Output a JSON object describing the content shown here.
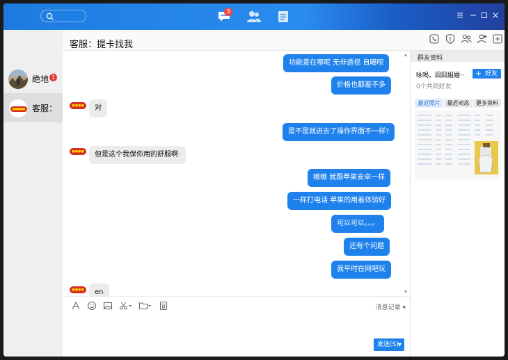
{
  "header": {
    "nav_badge": "3",
    "chat_title": "客服：提卡找我"
  },
  "sidebar": {
    "items": [
      {
        "name": "绝地",
        "unread": "1",
        "active": false
      },
      {
        "name": "客服：",
        "unread": "",
        "active": true
      }
    ]
  },
  "messages": [
    {
      "from": "me",
      "text": "功能差在哪呢    无非透视  自瞄呗"
    },
    {
      "from": "me",
      "text": "价格也都差不多"
    },
    {
      "from": "them",
      "text": "对"
    },
    {
      "from": "me",
      "text": "是不是就进去了操作界面不一样?"
    },
    {
      "from": "them",
      "text": "但是这个我保你用的舒服啊·"
    },
    {
      "from": "me",
      "text": "嗷嗷    就跟苹果安卓一样"
    },
    {
      "from": "me",
      "text": "一样打电话    苹果的用着体验好"
    },
    {
      "from": "me",
      "text": "可以可以。。。"
    },
    {
      "from": "me",
      "text": "还有个问题"
    },
    {
      "from": "me",
      "text": "我平时在网吧玩"
    },
    {
      "from": "them",
      "text": "en"
    }
  ],
  "toolbar": {
    "history_label": "消息记录",
    "send_label": "发送(S)"
  },
  "right_panel": {
    "title": "群友资料",
    "friend_name": "咏喝，囧囧姐婚··",
    "common_friends": "0个共同好友",
    "add_friend_label": "好友",
    "tabs": [
      "最近照片",
      "最近动态",
      "更多资料"
    ],
    "active_tab": 0
  },
  "colors": {
    "accent": "#1f82ec",
    "topbar": "#2a8cf0",
    "unread": "#e53935"
  }
}
